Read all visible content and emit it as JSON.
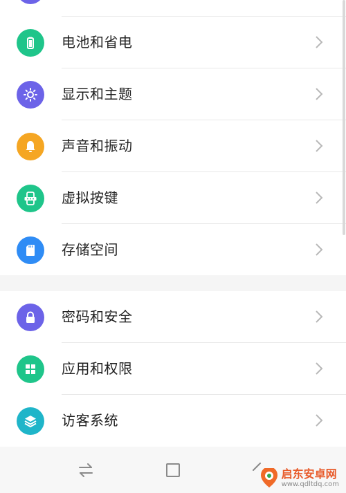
{
  "colors": {
    "purple": "#6c63e8",
    "green": "#1fc58a",
    "orange": "#f5a623",
    "blue": "#2f8cf5",
    "chevron": "#b8b8b8"
  },
  "group1": [
    {
      "label": "电池和省电",
      "icon": "battery-icon"
    },
    {
      "label": "显示和主题",
      "icon": "brightness-icon"
    },
    {
      "label": "声音和振动",
      "icon": "bell-icon"
    },
    {
      "label": "虚拟按键",
      "icon": "virtual-keys-icon"
    },
    {
      "label": "存储空间",
      "icon": "sd-card-icon"
    }
  ],
  "group2": [
    {
      "label": "密码和安全",
      "icon": "lock-icon"
    },
    {
      "label": "应用和权限",
      "icon": "apps-grid-icon"
    },
    {
      "label": "访客系统",
      "icon": "layers-icon"
    }
  ],
  "navbar": {
    "buttons": [
      "switch-icon",
      "home-square-icon",
      "back-icon"
    ]
  },
  "watermark": {
    "name": "启东安卓网",
    "url": "www.qdltdq.com"
  }
}
